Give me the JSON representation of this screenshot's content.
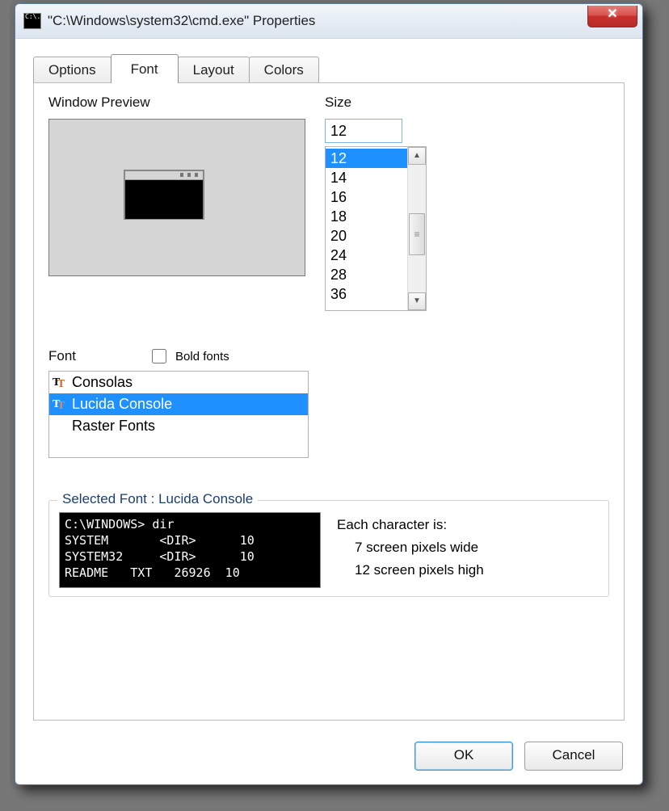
{
  "title": "\"C:\\Windows\\system32\\cmd.exe\" Properties",
  "tabs": [
    "Options",
    "Font",
    "Layout",
    "Colors"
  ],
  "activeTab": "Font",
  "labels": {
    "windowPreview": "Window Preview",
    "size": "Size",
    "font": "Font",
    "boldFonts": "Bold fonts"
  },
  "size": {
    "value": "12",
    "options": [
      "12",
      "14",
      "16",
      "18",
      "20",
      "24",
      "28",
      "36"
    ],
    "selected": "12"
  },
  "fonts": {
    "items": [
      {
        "name": "Consolas",
        "tt": true
      },
      {
        "name": "Lucida Console",
        "tt": true
      },
      {
        "name": "Raster Fonts",
        "tt": false
      }
    ],
    "selected": "Lucida Console"
  },
  "selectedGroup": {
    "title": "Selected Font : Lucida Console",
    "sampleLines": [
      "C:\\WINDOWS> dir",
      "SYSTEM       <DIR>      10",
      "SYSTEM32     <DIR>      10",
      "README   TXT   26926  10"
    ],
    "charInfoHeading": "Each character is:",
    "charWide": "7 screen pixels wide",
    "charHigh": "12 screen pixels high"
  },
  "buttons": {
    "ok": "OK",
    "cancel": "Cancel"
  },
  "closeGlyph": "✕"
}
